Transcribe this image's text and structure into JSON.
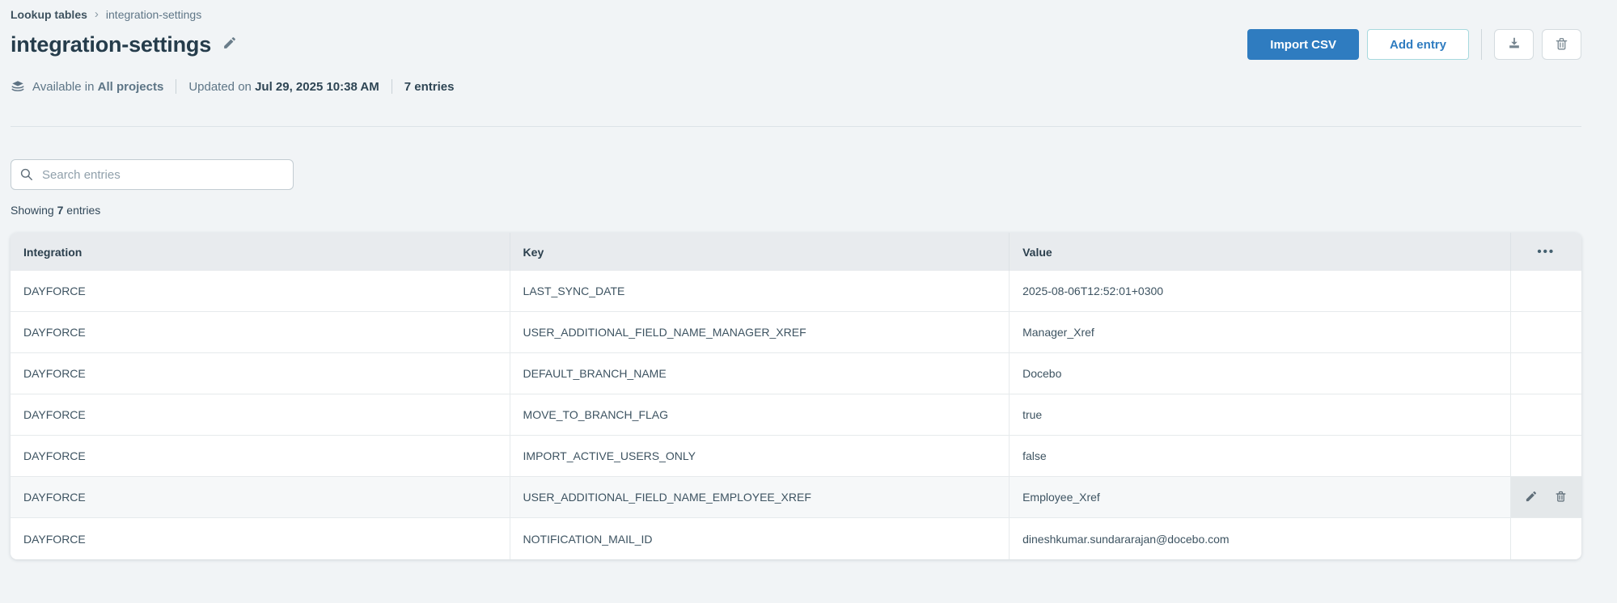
{
  "breadcrumb": {
    "items": [
      "Lookup tables",
      "integration-settings"
    ],
    "separator": "›"
  },
  "header": {
    "title": "integration-settings",
    "meta": {
      "availability_prefix": "Available in",
      "availability_value": "All projects",
      "updated_prefix": "Updated on",
      "updated_value": "Jul 29, 2025 10:38 AM",
      "entries_count": "7 entries"
    },
    "buttons": {
      "import_csv": "Import CSV",
      "add_entry": "Add entry"
    }
  },
  "search": {
    "placeholder": "Search entries",
    "value": ""
  },
  "showing": {
    "prefix": "Showing",
    "count": "7",
    "suffix": "entries"
  },
  "table": {
    "columns": [
      "Integration",
      "Key",
      "Value"
    ],
    "actions_header_glyph": "•••",
    "rows": [
      {
        "integration": "DAYFORCE",
        "key": "LAST_SYNC_DATE",
        "value": "2025-08-06T12:52:01+0300",
        "hovered": false
      },
      {
        "integration": "DAYFORCE",
        "key": "USER_ADDITIONAL_FIELD_NAME_MANAGER_XREF",
        "value": "Manager_Xref",
        "hovered": false
      },
      {
        "integration": "DAYFORCE",
        "key": "DEFAULT_BRANCH_NAME",
        "value": "Docebo",
        "hovered": false
      },
      {
        "integration": "DAYFORCE",
        "key": "MOVE_TO_BRANCH_FLAG",
        "value": "true",
        "hovered": false
      },
      {
        "integration": "DAYFORCE",
        "key": "IMPORT_ACTIVE_USERS_ONLY",
        "value": "false",
        "hovered": false
      },
      {
        "integration": "DAYFORCE",
        "key": "USER_ADDITIONAL_FIELD_NAME_EMPLOYEE_XREF",
        "value": "Employee_Xref",
        "hovered": true
      },
      {
        "integration": "DAYFORCE",
        "key": "NOTIFICATION_MAIL_ID",
        "value": "dineshkumar.sundararajan@docebo.com",
        "hovered": false
      }
    ]
  },
  "icons": {
    "breadcrumb_separator": "chevron-right-icon",
    "title_edit": "pencil-icon",
    "availability": "layers-stack-icon",
    "export": "download-icon",
    "delete_table": "trash-icon",
    "search": "magnifier-icon",
    "actions_header": "ellipsis-icon",
    "row_edit": "pencil-icon",
    "row_delete": "trash-icon"
  },
  "colors": {
    "primary_blue": "#2f7cc0",
    "secondary_border_teal": "#a7d9de",
    "page_background": "#f1f4f6",
    "table_header_background": "#e8ebee",
    "hover_row_background": "#f6f8f9",
    "hover_actions_background": "#e4e8ea",
    "dark_text": "#2b3f4d"
  }
}
